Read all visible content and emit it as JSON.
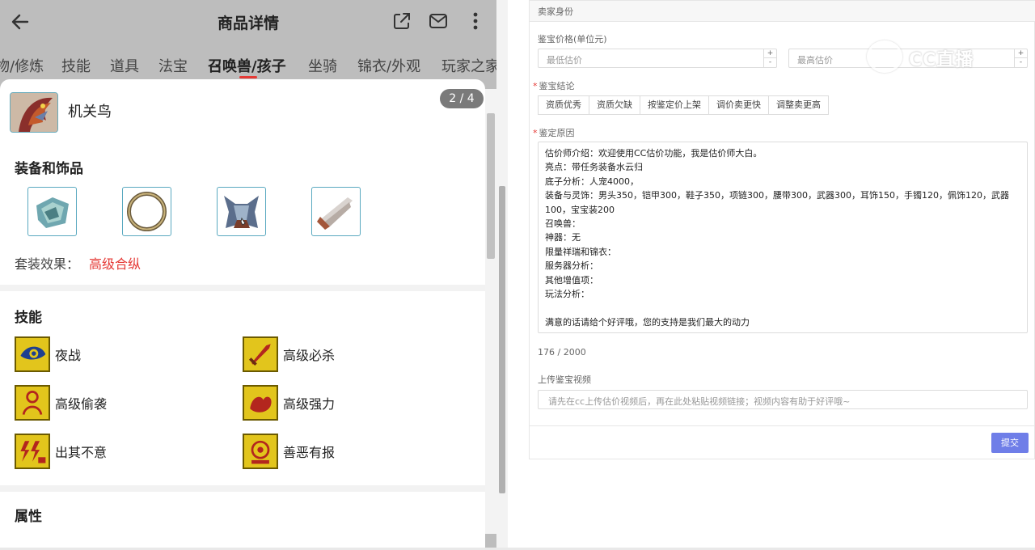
{
  "app": {
    "title": "商品详情",
    "tabs": [
      "物/修炼",
      "技能",
      "道具",
      "法宝",
      "召唤兽/孩子",
      "坐骑",
      "锦衣/外观",
      "玩家之家"
    ],
    "active_tab": "召唤兽/孩子"
  },
  "pet": {
    "name": "机关鸟",
    "pager": "2 / 4"
  },
  "equipment": {
    "title": "装备和饰品",
    "set_label": "套装效果：",
    "set_value": "高级合纵"
  },
  "skills": {
    "title": "技能",
    "items": [
      "夜战",
      "高级必杀",
      "高级偷袭",
      "高级强力",
      "出其不意",
      "善恶有报"
    ]
  },
  "attributes": {
    "title": "属性"
  },
  "form": {
    "header": "卖家身份",
    "price_label": "鉴宝价格(单位元)",
    "min_placeholder": "最低估价",
    "max_placeholder": "最高估价",
    "conclusion_label": "鉴宝结论",
    "conclusion_options": [
      "资质优秀",
      "资质欠缺",
      "按鉴定价上架",
      "调价卖更快",
      "调整卖更高"
    ],
    "reason_label": "鉴定原因",
    "reason_text": "估价师介绍：欢迎使用CC估价功能，我是估价师大白。\n亮点：带任务装备水云归\n底子分析：人宠4000，\n装备与灵饰：男头350，铠甲300，鞋子350，项链300，腰带300，武器300，耳饰150，手镯120，佩饰120，武器100，宝宝装200\n召唤兽：\n神器：无\n限量祥瑞和锦衣：\n服务器分析：\n其他增值项：\n玩法分析：\n\n满意的话请给个好评哦，您的支持是我们最大的动力",
    "counter": "176 / 2000",
    "video_label": "上传鉴宝视频",
    "video_placeholder": "请先在cc上传估价视频后，再在此处粘贴视频链接；视频内容有助于好评哦~",
    "submit_label": "提交",
    "required_mark": "*"
  },
  "watermark": {
    "text": "CC直播"
  },
  "colors": {
    "accent_red": "#e53935",
    "submit_blue": "#6f7ee8",
    "skill_gold": "#e2c51c"
  }
}
